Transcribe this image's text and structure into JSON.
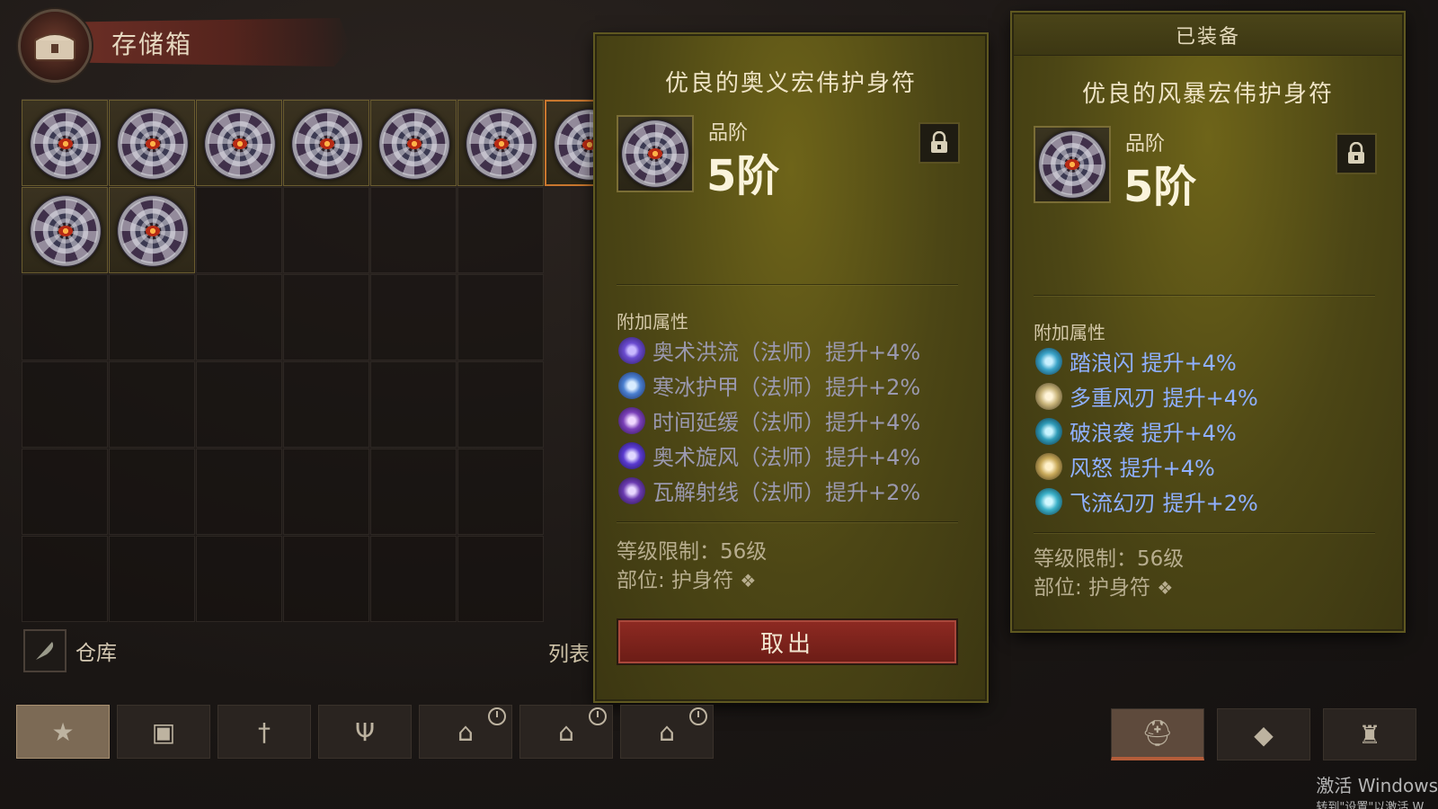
{
  "stash": {
    "title": "存储箱",
    "warehouse_label": "仓库",
    "list_label": "列表"
  },
  "tooltip_left": {
    "name": "优良的奥义宏伟护身符",
    "tier_label": "品阶",
    "tier_value": "5阶",
    "attr_heading": "附加属性",
    "attrs": [
      {
        "text": "奥术洪流（法师）提升+4%",
        "icon": "arcane-torrent-icon",
        "color": "#6a4bd0"
      },
      {
        "text": "寒冰护甲（法师）提升+2%",
        "icon": "frost-armor-icon",
        "color": "#4a7fd0"
      },
      {
        "text": "时间延缓（法师）提升+4%",
        "icon": "slow-time-icon",
        "color": "#7a3fb8"
      },
      {
        "text": "奥术旋风（法师）提升+4%",
        "icon": "arcane-vortex-icon",
        "color": "#5a3ad0"
      },
      {
        "text": "瓦解射线（法师）提升+2%",
        "icon": "disintegrate-icon",
        "color": "#6a3ab0"
      }
    ],
    "level_req": "等级限制：56级",
    "slot": "部位: 护身符",
    "take_out": "取出"
  },
  "tooltip_right": {
    "equipped_label": "已装备",
    "name": "优良的风暴宏伟护身符",
    "tier_label": "品阶",
    "tier_value": "5阶",
    "attr_heading": "附加属性",
    "attrs": [
      {
        "text": "踏浪闪  提升+4%",
        "icon": "wave-dash-icon",
        "color": "#3aa3c8"
      },
      {
        "text": "多重风刃  提升+4%",
        "icon": "wind-blades-icon",
        "color": "#c8b47a"
      },
      {
        "text": "破浪袭  提升+4%",
        "icon": "wave-strike-icon",
        "color": "#2f9bb8"
      },
      {
        "text": "风怒  提升+4%",
        "icon": "wind-fury-icon",
        "color": "#c8a95a"
      },
      {
        "text": "飞流幻刃  提升+2%",
        "icon": "flowing-blade-icon",
        "color": "#3ab0c8"
      }
    ],
    "level_req": "等级限制：56级",
    "slot": "部位: 护身符"
  },
  "tabs": [
    {
      "icon": "star-icon",
      "glyph": "★"
    },
    {
      "icon": "chest-icon",
      "glyph": "▣"
    },
    {
      "icon": "sword-icon",
      "glyph": "†"
    },
    {
      "icon": "trident-icon",
      "glyph": "Ψ"
    },
    {
      "icon": "timed-chest-icon",
      "glyph": "⌂"
    },
    {
      "icon": "timed-chest-icon",
      "glyph": "⌂"
    },
    {
      "icon": "timed-chest-icon",
      "glyph": "⌂"
    }
  ],
  "right_tabs": [
    {
      "icon": "helmet-icon",
      "glyph": "⛑"
    },
    {
      "icon": "crafting-icon",
      "glyph": "◆"
    },
    {
      "icon": "bag-icon",
      "glyph": "♜"
    }
  ],
  "system": {
    "activate_line1": "激活 Windows",
    "activate_line2": "转到\"设置\"以激活 W"
  }
}
